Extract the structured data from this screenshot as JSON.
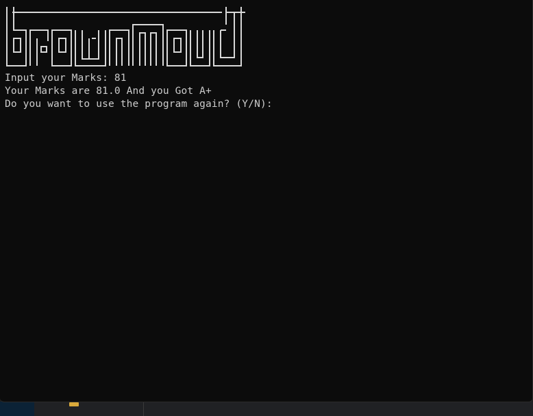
{
  "terminal": {
    "banner_text": "brownmoud",
    "lines": [
      {
        "prompt": "Input your Marks: ",
        "value": "81"
      },
      {
        "text": "Your Marks are 81.0 And you Got A+"
      },
      {
        "text": "Do you want to use the program again? (Y/N): "
      }
    ]
  },
  "colors": {
    "background": "#0c0c0c",
    "foreground": "#cccccc"
  }
}
